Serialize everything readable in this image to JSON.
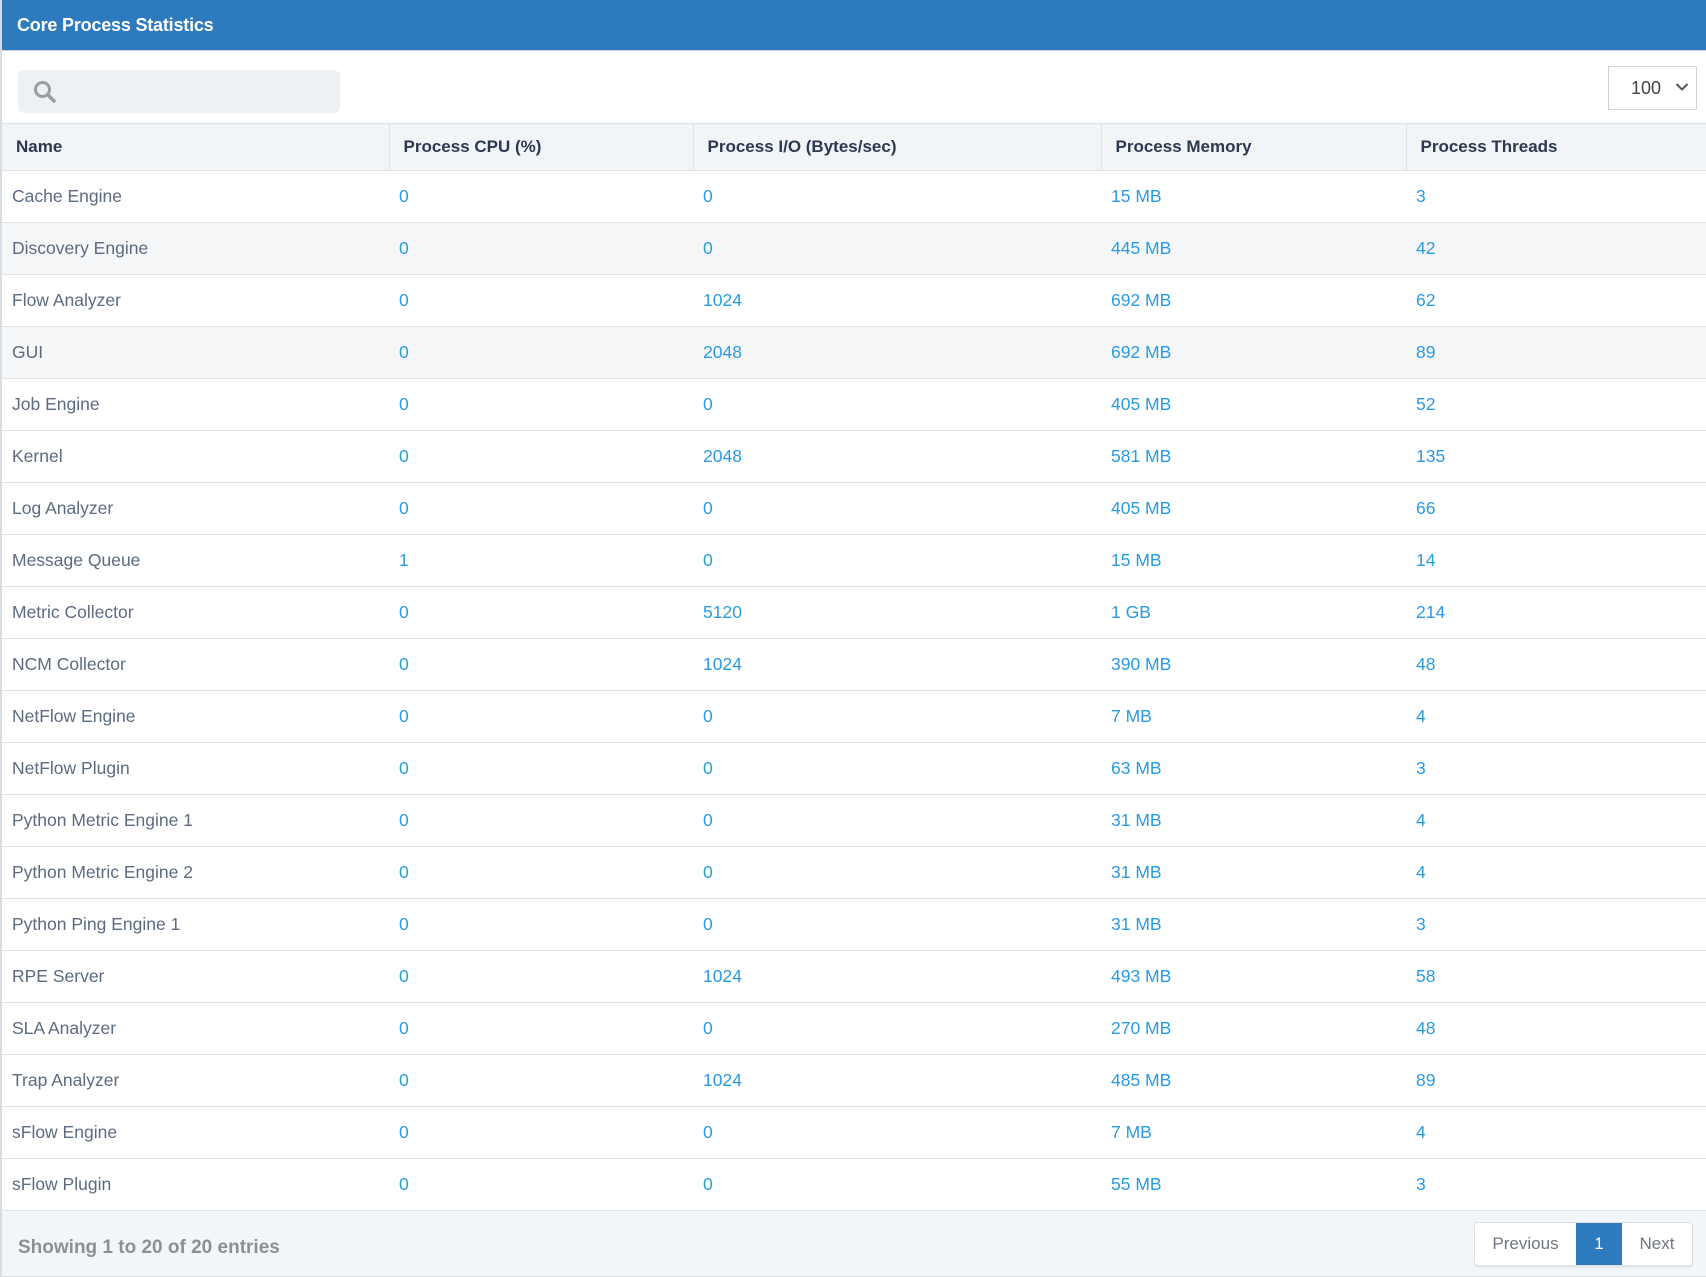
{
  "header": {
    "title": "Core Process Statistics"
  },
  "toolbar": {
    "search": {
      "placeholder": "",
      "value": ""
    },
    "page_size": {
      "selected": "100"
    }
  },
  "table": {
    "columns": [
      "Name",
      "Process CPU (%)",
      "Process I/O (Bytes/sec)",
      "Process Memory",
      "Process Threads"
    ],
    "rows": [
      {
        "name": "Cache Engine",
        "cpu": "0",
        "io": "0",
        "memory": "15 MB",
        "threads": "3"
      },
      {
        "name": "Discovery Engine",
        "cpu": "0",
        "io": "0",
        "memory": "445 MB",
        "threads": "42"
      },
      {
        "name": "Flow Analyzer",
        "cpu": "0",
        "io": "1024",
        "memory": "692 MB",
        "threads": "62"
      },
      {
        "name": "GUI",
        "cpu": "0",
        "io": "2048",
        "memory": "692 MB",
        "threads": "89"
      },
      {
        "name": "Job Engine",
        "cpu": "0",
        "io": "0",
        "memory": "405 MB",
        "threads": "52"
      },
      {
        "name": "Kernel",
        "cpu": "0",
        "io": "2048",
        "memory": "581 MB",
        "threads": "135"
      },
      {
        "name": "Log Analyzer",
        "cpu": "0",
        "io": "0",
        "memory": "405 MB",
        "threads": "66"
      },
      {
        "name": "Message Queue",
        "cpu": "1",
        "io": "0",
        "memory": "15 MB",
        "threads": "14"
      },
      {
        "name": "Metric Collector",
        "cpu": "0",
        "io": "5120",
        "memory": "1 GB",
        "threads": "214"
      },
      {
        "name": "NCM Collector",
        "cpu": "0",
        "io": "1024",
        "memory": "390 MB",
        "threads": "48"
      },
      {
        "name": "NetFlow Engine",
        "cpu": "0",
        "io": "0",
        "memory": "7 MB",
        "threads": "4"
      },
      {
        "name": "NetFlow Plugin",
        "cpu": "0",
        "io": "0",
        "memory": "63 MB",
        "threads": "3"
      },
      {
        "name": "Python Metric Engine 1",
        "cpu": "0",
        "io": "0",
        "memory": "31 MB",
        "threads": "4"
      },
      {
        "name": "Python Metric Engine 2",
        "cpu": "0",
        "io": "0",
        "memory": "31 MB",
        "threads": "4"
      },
      {
        "name": "Python Ping Engine 1",
        "cpu": "0",
        "io": "0",
        "memory": "31 MB",
        "threads": "3"
      },
      {
        "name": "RPE Server",
        "cpu": "0",
        "io": "1024",
        "memory": "493 MB",
        "threads": "58"
      },
      {
        "name": "SLA Analyzer",
        "cpu": "0",
        "io": "0",
        "memory": "270 MB",
        "threads": "48"
      },
      {
        "name": "Trap Analyzer",
        "cpu": "0",
        "io": "1024",
        "memory": "485 MB",
        "threads": "89"
      },
      {
        "name": "sFlow Engine",
        "cpu": "0",
        "io": "0",
        "memory": "7 MB",
        "threads": "4"
      },
      {
        "name": "sFlow Plugin",
        "cpu": "0",
        "io": "0",
        "memory": "55 MB",
        "threads": "3"
      }
    ],
    "shaded_rows": [
      1,
      3
    ]
  },
  "footer": {
    "info": "Showing 1 to 20 of 20 entries",
    "pagination": {
      "previous": "Previous",
      "current_page": "1",
      "next": "Next"
    }
  },
  "colors": {
    "accent": "#2d7abf",
    "link_value": "#2a9be0",
    "name_text": "#5d6b80",
    "header_text": "#2c3850"
  },
  "icons": {
    "search": "search-icon",
    "dropdown": "chevron-down-icon"
  }
}
